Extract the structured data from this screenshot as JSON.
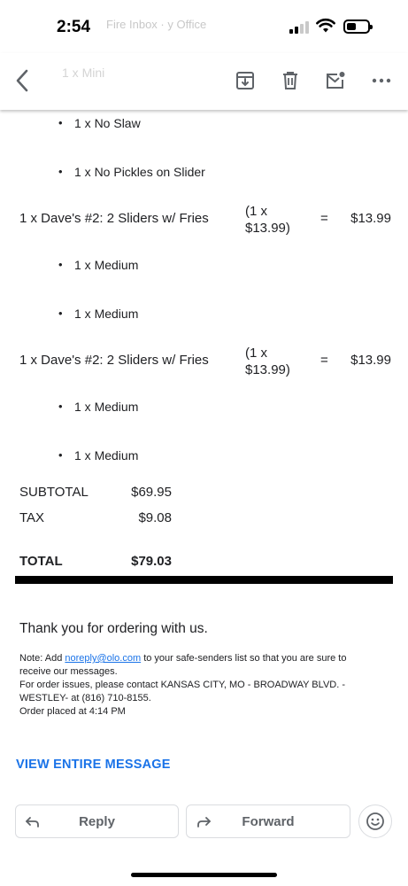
{
  "status_bar": {
    "time": "2:54",
    "ghost_text": "Fire Inbox · y Office"
  },
  "toolbar": {
    "ghost_item": "1 x Mini",
    "icons": [
      "back-arrow-icon",
      "archive-icon",
      "trash-icon",
      "mark-unread-icon",
      "more-icon"
    ]
  },
  "order": {
    "bullets_top": [
      {
        "qty": "1 x No Slaw"
      },
      {
        "qty": "1 x No Pickles on Slider"
      }
    ],
    "items": [
      {
        "name": "1 x Dave's #2: 2 Sliders w/ Fries",
        "calc_line1": "(1 x",
        "calc_line2": "$13.99)",
        "eq": "=",
        "total": "$13.99",
        "options": [
          "1 x Medium",
          "1 x Medium"
        ]
      },
      {
        "name": "1 x Dave's #2: 2 Sliders w/ Fries",
        "calc_line1": "(1 x",
        "calc_line2": "$13.99)",
        "eq": "=",
        "total": "$13.99",
        "options": [
          "1 x Medium",
          "1 x Medium"
        ]
      }
    ],
    "subtotal_label": "SUBTOTAL",
    "subtotal_value": "$69.95",
    "tax_label": "TAX",
    "tax_value": "$9.08",
    "total_label": "TOTAL",
    "total_value": "$79.03"
  },
  "footer": {
    "thanks": "Thank you for ordering with us.",
    "note_prefix": "Note: Add ",
    "note_link": "noreply@olo.com",
    "note_suffix": " to your safe-senders list so that you are sure to receive our messages.",
    "issues": "For order issues, please contact KANSAS CITY, MO - BROADWAY BLVD. - WESTLEY- at (816) 710-8155.",
    "placed": "Order placed at 4:14 PM",
    "view_entire": "VIEW ENTIRE MESSAGE"
  },
  "actions": {
    "reply": "Reply",
    "forward": "Forward"
  }
}
